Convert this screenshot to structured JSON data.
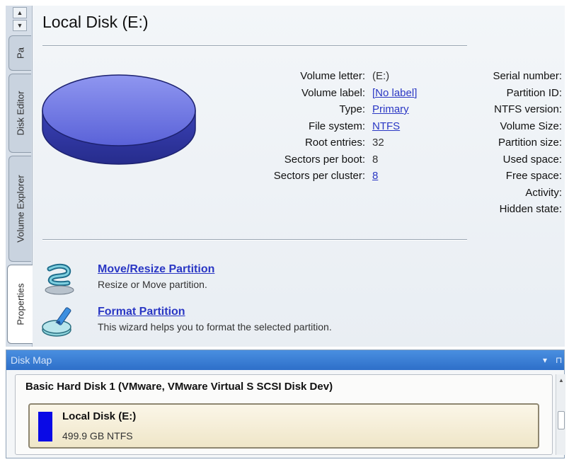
{
  "tabs": [
    {
      "label": "Pa"
    },
    {
      "label": "Disk Editor"
    },
    {
      "label": "Volume Explorer"
    },
    {
      "label": "Properties"
    }
  ],
  "panel": {
    "title": "Local Disk (E:)",
    "properties_middle": [
      {
        "label": "Volume letter:",
        "value": "(E:)",
        "link": false
      },
      {
        "label": "Volume label:",
        "value": "[No label]",
        "link": true
      },
      {
        "label": "Type:",
        "value": "Primary",
        "link": true
      },
      {
        "label": "File system:",
        "value": "NTFS",
        "link": true
      },
      {
        "label": "Root entries:",
        "value": "32",
        "link": false
      },
      {
        "label": "Sectors per boot:",
        "value": "8",
        "link": false
      },
      {
        "label": "Sectors per cluster:",
        "value": "8",
        "link": true
      }
    ],
    "properties_right": [
      {
        "label": "Serial number:"
      },
      {
        "label": "Partition ID:"
      },
      {
        "label": "NTFS version:"
      },
      {
        "label": "Volume Size:"
      },
      {
        "label": "Partition size:"
      },
      {
        "label": "Used space:"
      },
      {
        "label": "Free space:"
      },
      {
        "label": "Activity:"
      },
      {
        "label": "Hidden state:"
      }
    ],
    "actions": [
      {
        "title": "Move/Resize Partition",
        "description": "Resize or Move partition.",
        "icon": "move-resize-icon"
      },
      {
        "title": "Format Partition",
        "description": "This wizard helps you to format the selected partition.",
        "icon": "format-partition-icon"
      }
    ]
  },
  "disk_map": {
    "header": "Disk Map",
    "disk_title": "Basic Hard Disk 1 (VMware, VMware Virtual S SCSI Disk Dev)",
    "partition": {
      "name": "Local Disk (E:)",
      "info": "499.9 GB NTFS",
      "color": "#0a0ae6"
    }
  },
  "colors": {
    "link": "#2a37c4",
    "header_blue": "#2e6fc9",
    "disk_purple": "#5a62d8"
  }
}
